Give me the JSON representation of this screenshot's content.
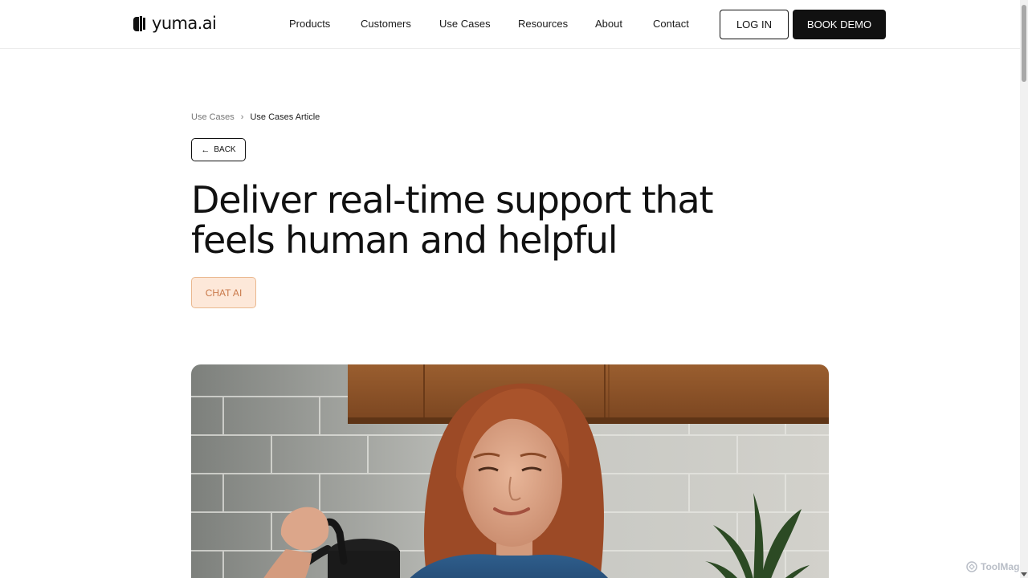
{
  "brand": {
    "name": "yuma.ai"
  },
  "nav": {
    "items": [
      {
        "label": "Products"
      },
      {
        "label": "Customers"
      },
      {
        "label": "Use Cases"
      },
      {
        "label": "Resources"
      },
      {
        "label": "About"
      },
      {
        "label": "Contact"
      }
    ],
    "login_label": "LOG IN",
    "demo_label": "BOOK DEMO"
  },
  "breadcrumb": {
    "parent": "Use Cases",
    "current": "Use Cases Article"
  },
  "back_button": {
    "label": "BACK"
  },
  "article": {
    "title": "Deliver real-time support that feels human and helpful",
    "tag": "CHAT AI"
  },
  "hero_image": {
    "description_icon": "photo-woman-pouring-kettle"
  },
  "watermark": {
    "text": "ToolMage"
  },
  "colors": {
    "demo_button_bg": "#111111",
    "tag_bg": "#fde8d9",
    "tag_border": "#eab88f",
    "tag_text": "#c9794a"
  }
}
